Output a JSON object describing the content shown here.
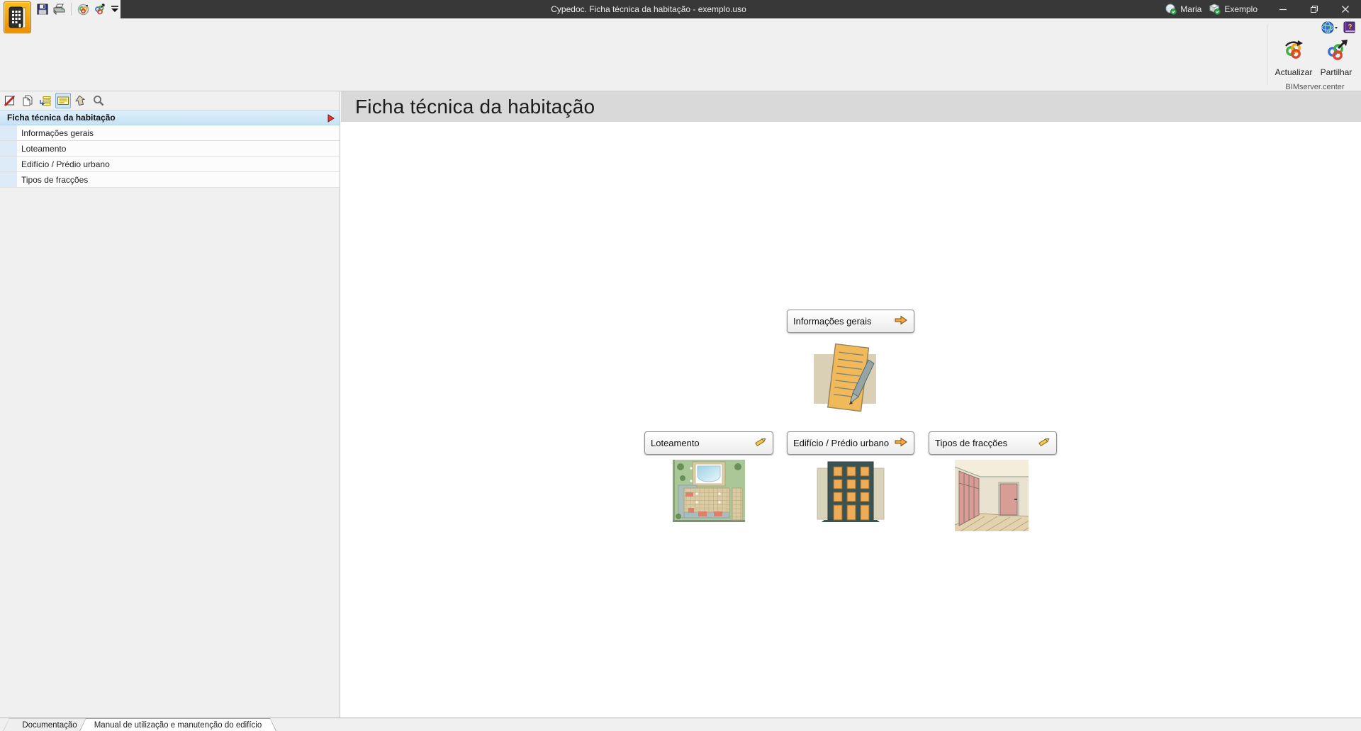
{
  "window": {
    "title": "Cypedoc. Ficha técnica da habitação - exemplo.uso",
    "account": {
      "user": "Maria",
      "project": "Exemplo"
    },
    "controls": [
      "minimize",
      "restore",
      "close"
    ]
  },
  "quick_access": {
    "icons": [
      "app-icon",
      "save-icon",
      "print-icon",
      "bimserver-update-icon",
      "bimserver-share-icon",
      "customize-toolbar-icon"
    ]
  },
  "ribbon": {
    "top_icons": [
      "language-globe-icon",
      "help-book-icon"
    ],
    "buttons": [
      {
        "label": "Actualizar",
        "icon": "bimserver-update-icon"
      },
      {
        "label": "Partilhar",
        "icon": "bimserver-share-icon"
      }
    ],
    "group_label": "BIMserver.center"
  },
  "sidebar": {
    "toolbar_icons": [
      "edit-report-icon",
      "new-document-icon",
      "import-list-icon",
      "form-view-icon",
      "export-up-icon",
      "search-icon"
    ],
    "tree": {
      "root": "Ficha técnica da habitação",
      "children": [
        "Informações gerais",
        "Loteamento",
        "Edifício / Prédio urbano",
        "Tipos de fracções"
      ]
    }
  },
  "main": {
    "title": "Ficha técnica da habitação",
    "cards": [
      {
        "label": "Informações gerais",
        "icon": "arrow-right"
      },
      {
        "label": "Loteamento",
        "icon": "pencil"
      },
      {
        "label": "Edifício / Prédio urbano",
        "icon": "arrow-right"
      },
      {
        "label": "Tipos de fracções",
        "icon": "pencil"
      }
    ],
    "illustrations": [
      "document-pencil",
      "site-plan",
      "building",
      "interior-doors"
    ]
  },
  "footer": {
    "tabs": [
      {
        "label": "Documentação",
        "active": false
      },
      {
        "label": "Manual de utilização e manutenção do edifício",
        "active": true
      }
    ]
  },
  "colors": {
    "titlebar": "#383838",
    "ribbon": "#f0f0f0",
    "header_bar": "#d9d9d9",
    "selected_row": "#cde4f5",
    "accent_orange": "#f5a623",
    "app_icon_orange": "#f09a00"
  }
}
